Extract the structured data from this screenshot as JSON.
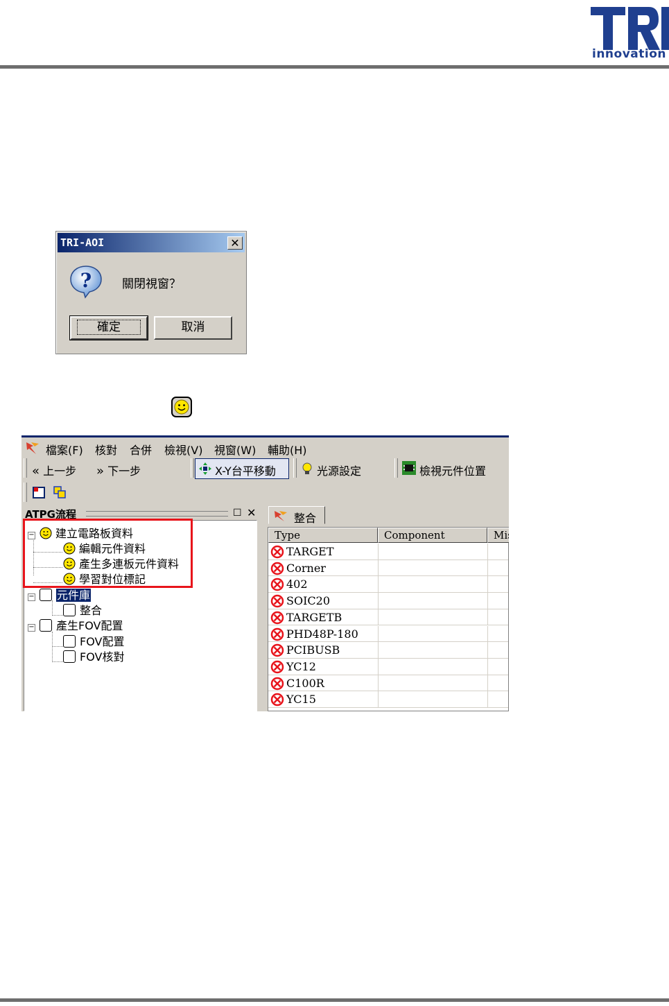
{
  "header": {
    "logo_text": "TRI",
    "logo_subtext": "innovation"
  },
  "dialog": {
    "title": "TRI-AOI",
    "close_glyph": "✕",
    "icon": "question-icon",
    "message": "關閉視窗？",
    "ok_label": "確定",
    "cancel_label": "取消"
  },
  "app": {
    "menu": [
      "檔案(F)",
      "核對",
      "合併",
      "檢視(V)",
      "視窗(W)",
      "輔助(H)"
    ],
    "toolbar": {
      "back_label": "上一步",
      "next_label": "下一步",
      "xy_label": "X-Y台平移動",
      "light_label": "光源設定",
      "view_label": "檢視元件位置"
    },
    "left_panel": {
      "title": "ATPG流程",
      "tree": [
        {
          "label": "建立電路板資料",
          "icon": "smiley-icon"
        },
        {
          "label": "編輯元件資料",
          "icon": "smiley-icon"
        },
        {
          "label": "產生多連板元件資料",
          "icon": "smiley-icon"
        },
        {
          "label": "學習對位標記",
          "icon": "smiley-icon"
        },
        {
          "label": "元件庫",
          "icon": "checkbox-icon"
        },
        {
          "label": "整合",
          "icon": "checkbox-icon"
        },
        {
          "label": "產生FOV配置",
          "icon": "checkbox-icon"
        },
        {
          "label": "FOV配置",
          "icon": "checkbox-icon"
        },
        {
          "label": "FOV核對",
          "icon": "checkbox-icon"
        }
      ]
    },
    "right_panel": {
      "tab_label": "整合",
      "columns": [
        "Type",
        "Component",
        "Mis"
      ],
      "rows": [
        "TARGET",
        "Corner",
        "402",
        "SOIC20",
        "TARGETB",
        "PHD48P-180",
        "PCIBUSB",
        "YC12",
        "C100R",
        "YC15"
      ]
    }
  },
  "colors": {
    "title_bar": "#0a246a",
    "highlight_box": "#e8141b",
    "error_icon": "#e8141b",
    "logo": "#1f3f8f"
  }
}
